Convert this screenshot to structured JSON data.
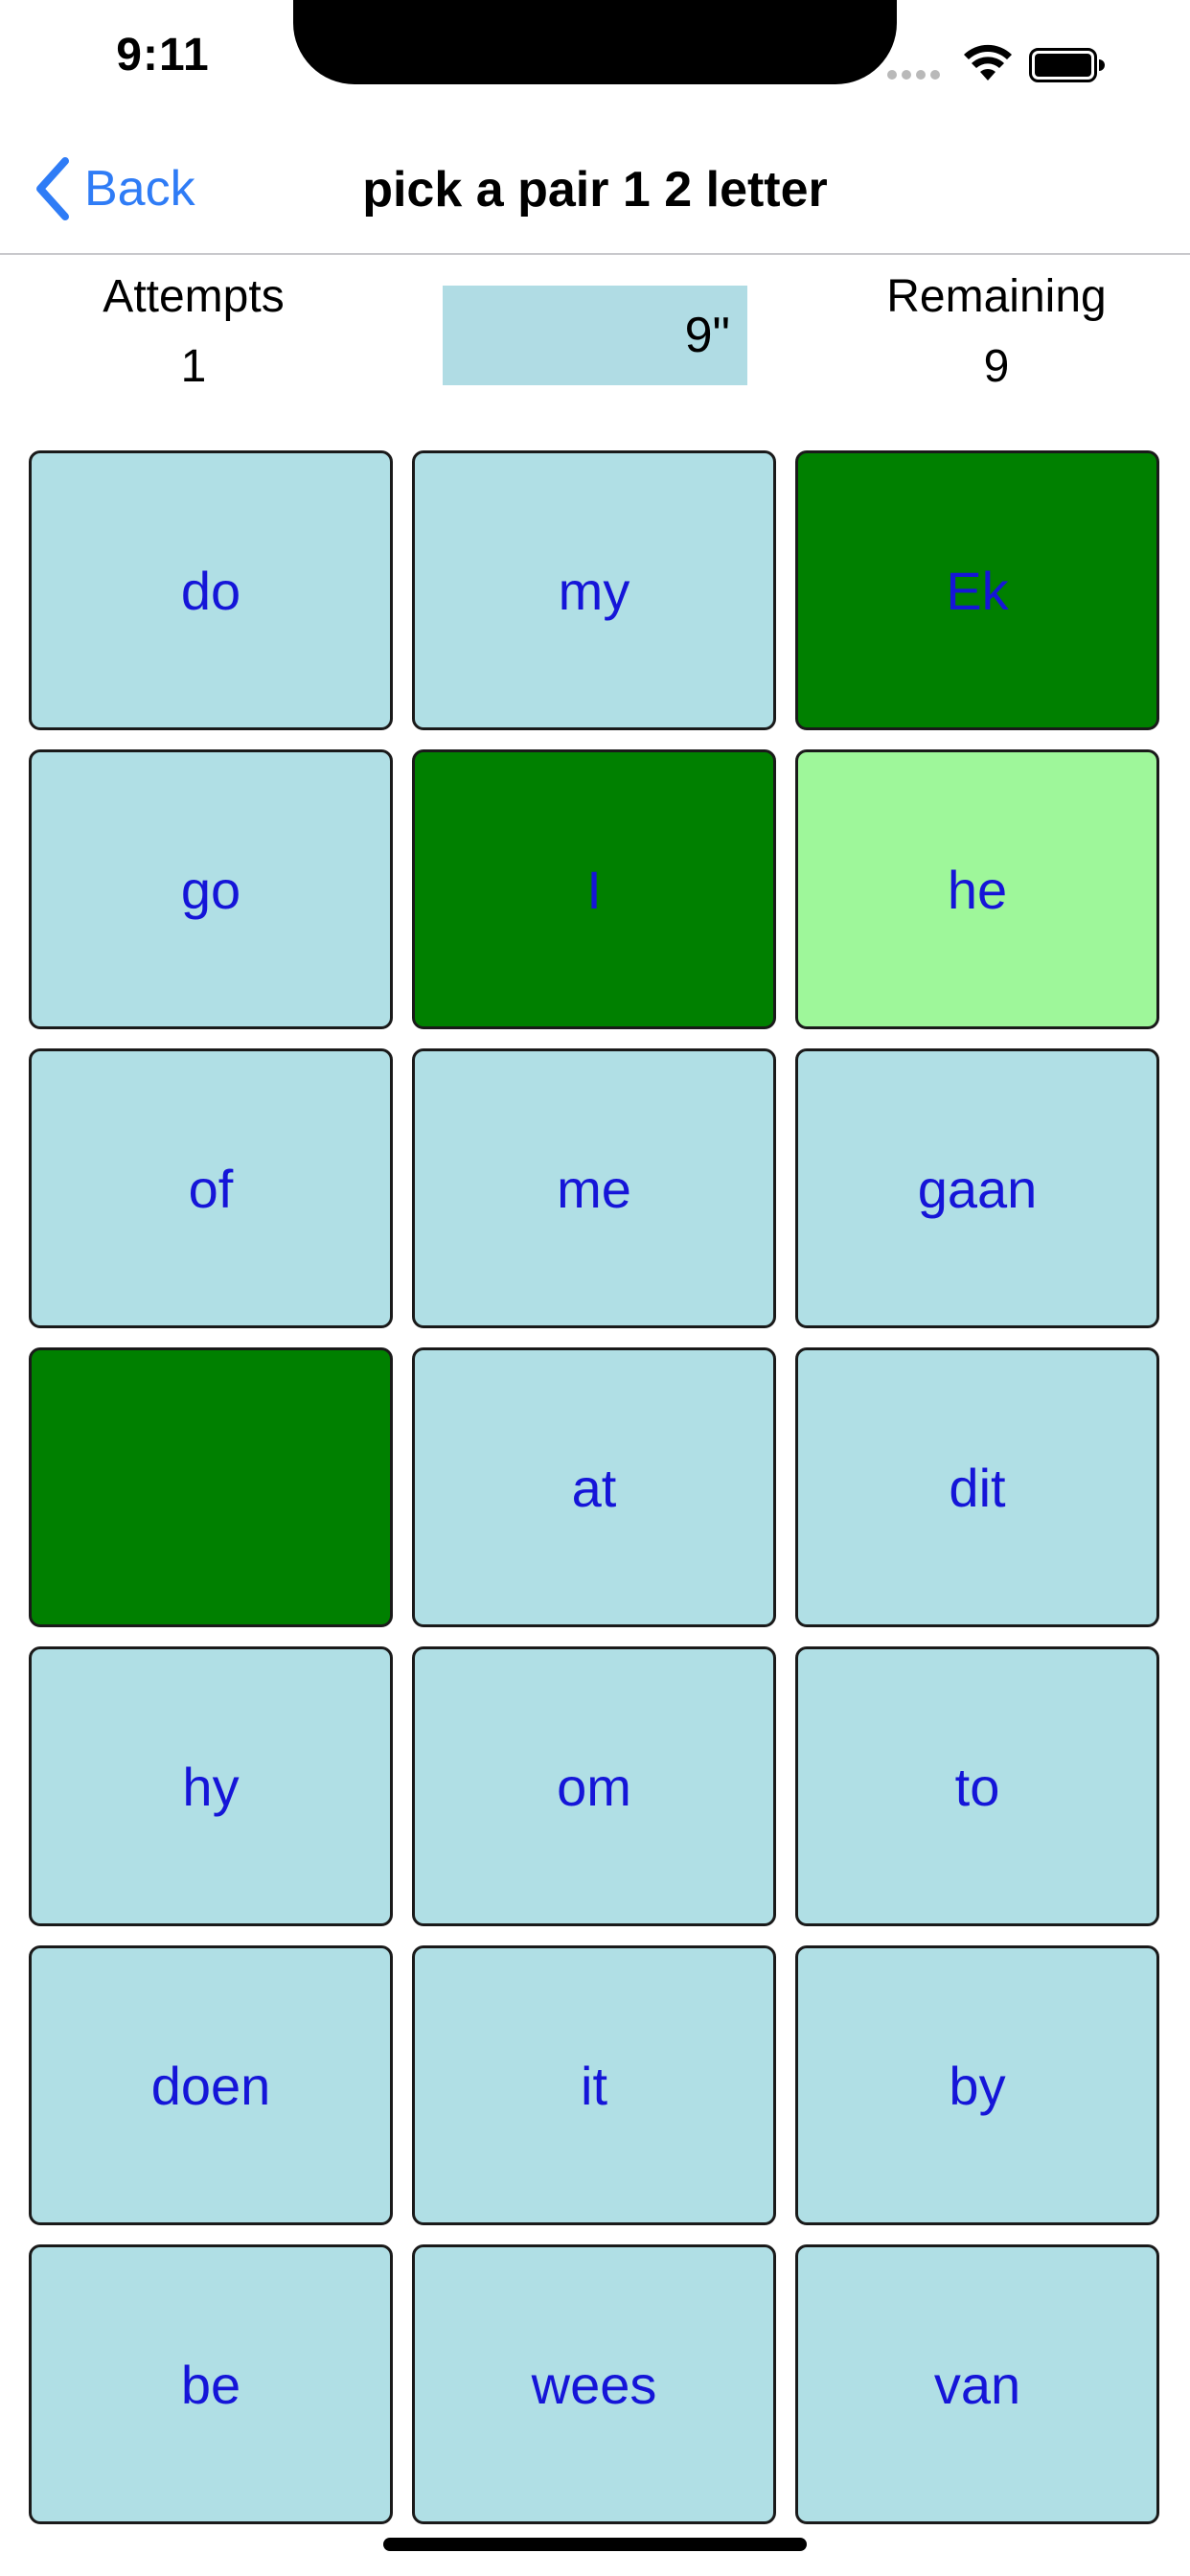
{
  "status_bar": {
    "time": "9:11"
  },
  "nav": {
    "back_label": "Back",
    "title": "pick a pair 1 2 letter"
  },
  "stats": {
    "attempts_label": "Attempts",
    "attempts_value": "1",
    "timer": "9\"",
    "remaining_label": "Remaining",
    "remaining_value": "9"
  },
  "colors": {
    "tile_default": "#b0dfe5",
    "tile_matched": "#008000",
    "tile_selected": "#9ef79a",
    "tile_text": "#1515d8",
    "timer_background": "#b0dce4",
    "accent": "#2f7cf6"
  },
  "grid": {
    "tiles": [
      {
        "label": "do",
        "state": "default"
      },
      {
        "label": "my",
        "state": "default"
      },
      {
        "label": "Ek",
        "state": "matched"
      },
      {
        "label": "go",
        "state": "default"
      },
      {
        "label": "I",
        "state": "matched"
      },
      {
        "label": "he",
        "state": "selected"
      },
      {
        "label": "of",
        "state": "default"
      },
      {
        "label": "me",
        "state": "default"
      },
      {
        "label": "gaan",
        "state": "default"
      },
      {
        "label": "",
        "state": "matched"
      },
      {
        "label": "at",
        "state": "default"
      },
      {
        "label": "dit",
        "state": "default"
      },
      {
        "label": "hy",
        "state": "default"
      },
      {
        "label": "om",
        "state": "default"
      },
      {
        "label": "to",
        "state": "default"
      },
      {
        "label": "doen",
        "state": "default"
      },
      {
        "label": "it",
        "state": "default"
      },
      {
        "label": "by",
        "state": "default"
      },
      {
        "label": "be",
        "state": "default"
      },
      {
        "label": "wees",
        "state": "default"
      },
      {
        "label": "van",
        "state": "default"
      }
    ]
  }
}
